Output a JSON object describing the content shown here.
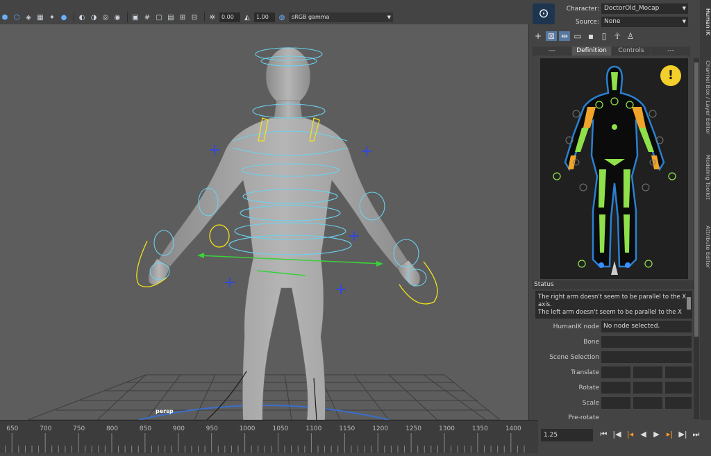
{
  "toolbar": {
    "icons": [
      "isolate-cube-icon",
      "wire-cube-icon",
      "smooth-cube-icon",
      "checker-icon",
      "light-icon",
      "ao-icon",
      "shadow-icon",
      "motion-blur-icon",
      "aa-icon",
      "dof-icon",
      "screen-icon",
      "grid-toggle-icon",
      "film-gate-icon",
      "resolution-gate-icon",
      "safe-action-icon",
      "field-chart-icon",
      "exposure-icon",
      "gamma-icon"
    ],
    "exposure_value": "0.00",
    "gamma_value": "1.00",
    "colorspace": "sRGB gamma"
  },
  "viewport": {
    "camera_label": "persp"
  },
  "hik": {
    "character_label": "Character:",
    "character_value": "DoctorOld_Mocap",
    "source_label": "Source:",
    "source_value": "None",
    "tabs": [
      "---",
      "Definition",
      "Controls",
      "---"
    ],
    "status_header": "Status",
    "status_text": "The right arm doesn't seem to be parallel to the X axis.\nThe left arm doesn't seem to be parallel to the X",
    "fields": {
      "humanik_node_label": "HumanIK node",
      "humanik_node_value": "No node selected.",
      "bone_label": "Bone",
      "scene_selection_label": "Scene Selection",
      "translate_label": "Translate",
      "rotate_label": "Rotate",
      "scale_label": "Scale",
      "prerotate_label": "Pre-rotate"
    }
  },
  "side_tabs": [
    "Human IK",
    "Channel Box / Layer Editor",
    "Modeling Toolkit",
    "Attribute Editor"
  ],
  "timeline": {
    "ticks": [
      650,
      700,
      750,
      800,
      850,
      900,
      950,
      1000,
      1050,
      1100,
      1150,
      1200,
      1250,
      1300,
      1350,
      1400
    ],
    "tick_range": [
      632,
      1420
    ],
    "current_time": "1.25"
  },
  "colors": {
    "accent_orange": "#ff9a2a",
    "limb_green": "#8fe04a",
    "limb_orange": "#f0a429",
    "rig_cyan": "#6ad2f0",
    "rig_yellow": "#f2e41a",
    "warning": "#f2cf2a"
  }
}
